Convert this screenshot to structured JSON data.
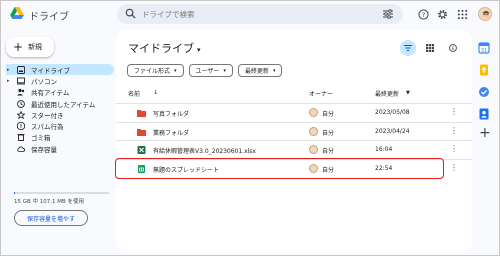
{
  "app": {
    "brand": "ドライブ"
  },
  "search": {
    "placeholder": "ドライブで検索"
  },
  "sidebar": {
    "new_label": "新規",
    "items": [
      {
        "label": "マイドライブ",
        "icon": "my-drive-icon",
        "active": true,
        "caret": true
      },
      {
        "label": "パソコン",
        "icon": "computer-icon",
        "caret": true
      },
      {
        "label": "共有アイテム",
        "icon": "shared-icon"
      },
      {
        "label": "最近使用したアイテム",
        "icon": "recent-icon"
      },
      {
        "label": "スター付き",
        "icon": "star-icon"
      },
      {
        "label": "スパム行為",
        "icon": "spam-icon"
      },
      {
        "label": "ゴミ箱",
        "icon": "trash-icon"
      },
      {
        "label": "保存容量",
        "icon": "cloud-icon"
      }
    ],
    "storage_text": "15 GB 中 107.1 MB を使用",
    "storage_used_fraction": 0.007,
    "storage_button": "保存容量を増やす"
  },
  "main": {
    "title": "マイドライブ",
    "filters": [
      "ファイル形式",
      "ユーザー",
      "最終更新"
    ],
    "columns": {
      "name": "名前",
      "sort_arrow": "↓",
      "owner": "オーナー",
      "modified": "最終更新",
      "modified_arrow": "▼"
    },
    "rows": [
      {
        "name": "写真フォルダ",
        "type": "folder-red",
        "owner": "自分",
        "modified": "2023/05/08"
      },
      {
        "name": "業務フォルダ",
        "type": "folder-red",
        "owner": "自分",
        "modified": "2023/04/24"
      },
      {
        "name": "有給休暇管理表V3.0_20230601.xlsx",
        "type": "excel",
        "owner": "自分",
        "modified": "16:04"
      },
      {
        "name": "無題のスプレッドシート",
        "type": "sheets",
        "owner": "自分",
        "modified": "22:54",
        "highlighted": true
      }
    ]
  },
  "colors": {
    "active_bg": "#c2e7ff",
    "highlight": "#e0201b",
    "folder": "#e0463a",
    "excel": "#1e7145",
    "sheets": "#0f9d58"
  }
}
